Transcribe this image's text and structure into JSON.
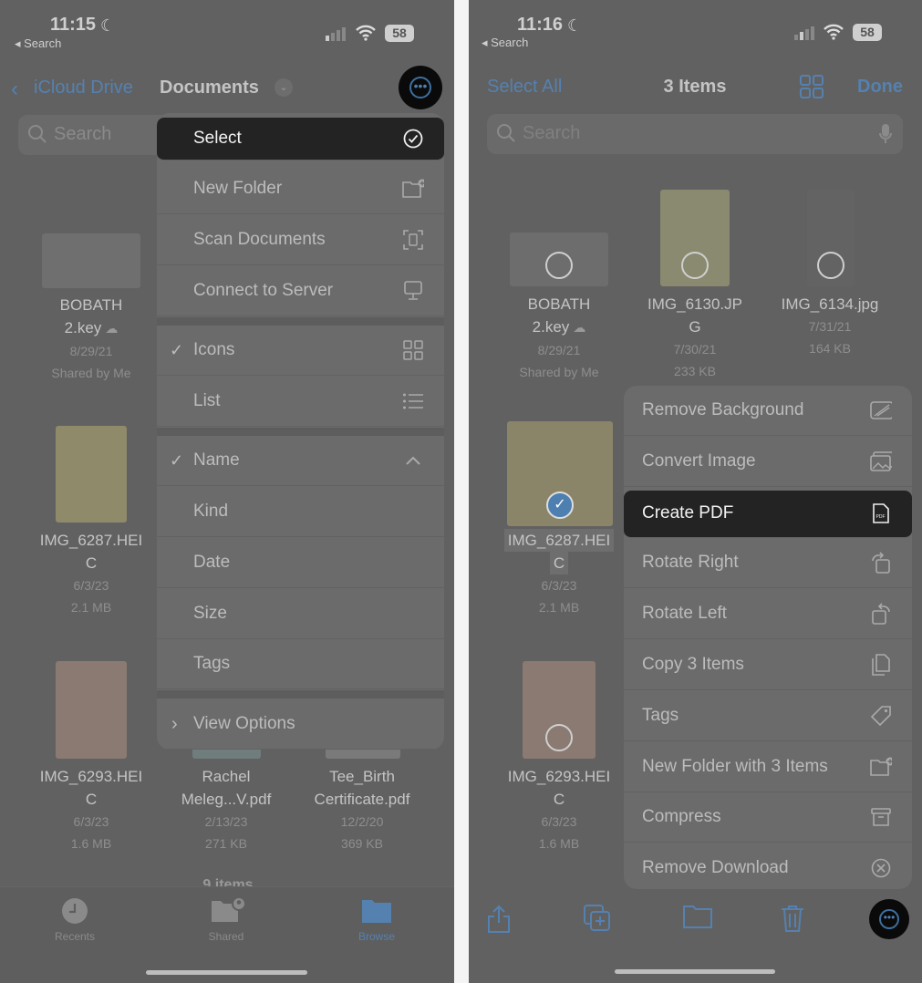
{
  "left": {
    "status": {
      "time": "11:15",
      "back": "◂ Search",
      "battery": "58"
    },
    "nav": {
      "back_label": "iCloud Drive",
      "title": "Documents"
    },
    "search": {
      "placeholder": "Search"
    },
    "menu": [
      {
        "label": "Select",
        "icon": "checkmark-circle-icon",
        "highlighted": true
      },
      {
        "label": "New Folder",
        "icon": "folder-plus-icon"
      },
      {
        "label": "Scan Documents",
        "icon": "scan-icon"
      },
      {
        "label": "Connect to Server",
        "icon": "monitor-icon"
      },
      {
        "label": "Icons",
        "icon": "grid-icon",
        "checked": true
      },
      {
        "label": "List",
        "icon": "list-icon"
      },
      {
        "label": "Name",
        "icon": "chevron-up-icon",
        "checked": true
      },
      {
        "label": "Kind"
      },
      {
        "label": "Date"
      },
      {
        "label": "Size"
      },
      {
        "label": "Tags"
      },
      {
        "label": "View Options",
        "chevron": true
      }
    ],
    "files": [
      {
        "name": [
          "BOBATH",
          "2.key"
        ],
        "meta": [
          "8/29/21",
          "Shared by Me"
        ],
        "cloud": true
      },
      {
        "name": [
          "IMG_6287.HEI",
          "C"
        ],
        "meta": [
          "6/3/23",
          "2.1 MB"
        ]
      },
      {
        "name": [
          "IMG_6293.HEI",
          "C"
        ],
        "meta": [
          "6/3/23",
          "1.6 MB"
        ]
      },
      {
        "name": [
          "Rachel",
          "Meleg...V.pdf"
        ],
        "meta": [
          "2/13/23",
          "271 KB"
        ]
      },
      {
        "name": [
          "Tee_Birth",
          "Certificate.pdf"
        ],
        "meta": [
          "12/2/20",
          "369 KB"
        ]
      }
    ],
    "count": "9 items",
    "tabs": [
      {
        "label": "Recents"
      },
      {
        "label": "Shared"
      },
      {
        "label": "Browse",
        "active": true
      }
    ]
  },
  "right": {
    "status": {
      "time": "11:16",
      "back": "◂ Search",
      "battery": "58"
    },
    "nav": {
      "select_all": "Select All",
      "title": "3 Items",
      "done": "Done"
    },
    "search": {
      "placeholder": "Search"
    },
    "files": [
      {
        "name": [
          "BOBATH",
          "2.key"
        ],
        "meta": [
          "8/29/21",
          "Shared by Me"
        ],
        "cloud": true
      },
      {
        "name": [
          "IMG_6130.JP",
          "G"
        ],
        "meta": [
          "7/30/21",
          "233 KB"
        ]
      },
      {
        "name": [
          "IMG_6134.jpg"
        ],
        "meta": [
          "7/31/21",
          "164 KB"
        ]
      },
      {
        "name": [
          "IMG_6287.HEI",
          "C"
        ],
        "meta": [
          "6/3/23",
          "2.1 MB"
        ],
        "selected": true
      },
      {
        "name": [
          "IMG_6293.HEI",
          "C"
        ],
        "meta": [
          "6/3/23",
          "1.6 MB"
        ]
      }
    ],
    "menu": [
      {
        "label": "Remove Background",
        "icon": "remove-background-icon"
      },
      {
        "label": "Convert Image",
        "icon": "photos-icon"
      },
      {
        "label": "Create PDF",
        "icon": "pdf-icon",
        "highlighted": true
      },
      {
        "label": "Rotate Right",
        "icon": "rotate-right-icon"
      },
      {
        "label": "Rotate Left",
        "icon": "rotate-left-icon"
      },
      {
        "label": "Copy 3 Items",
        "icon": "copy-icon"
      },
      {
        "label": "Tags",
        "icon": "tag-icon"
      },
      {
        "label": "New Folder with 3 Items",
        "icon": "folder-plus-icon"
      },
      {
        "label": "Compress",
        "icon": "archive-icon"
      },
      {
        "label": "Remove Download",
        "icon": "x-circle-icon"
      }
    ],
    "toolbar": [
      "share-icon",
      "duplicate-icon",
      "folder-icon",
      "trash-icon",
      "more-icon"
    ]
  },
  "colors": {
    "accent": "#5581b0",
    "highlight": "#232323",
    "background": "#616161"
  }
}
